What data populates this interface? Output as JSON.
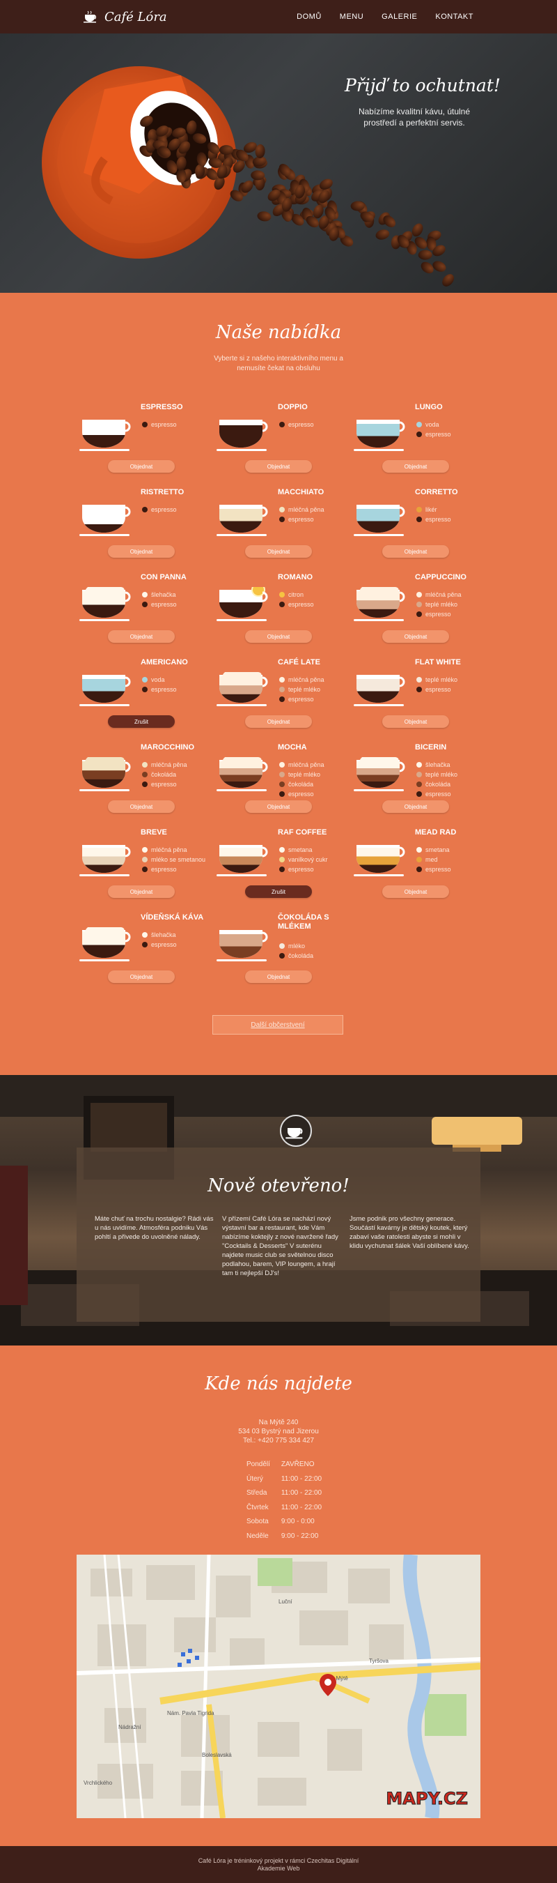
{
  "brand": {
    "name": "Café Lóra"
  },
  "nav": {
    "items": [
      "DOMŮ",
      "MENU",
      "GALERIE",
      "KONTAKT"
    ]
  },
  "hero": {
    "title": "Přijď to ochutnat!",
    "subtitle": "Nabízíme kvalitní kávu, útulné prostředí a perfektní servis."
  },
  "menu": {
    "title": "Naše nabídka",
    "subtitle": "Vyberte si z našeho interaktivního menu a nemusíte čekat na obsluhu",
    "detail_button": "Další občerstvení",
    "order_label": "Objednat",
    "soldout_label": "Zrušit",
    "items": [
      {
        "name": "ESPRESSO",
        "layers": [
          "#3b1a10"
        ],
        "fill": 0.45,
        "ings": [
          [
            "espresso",
            "#3b1a10"
          ]
        ]
      },
      {
        "name": "DOPPIO",
        "layers": [
          "#3b1a10"
        ],
        "fill": 0.8,
        "ings": [
          [
            "espresso",
            "#3b1a10"
          ]
        ]
      },
      {
        "name": "LUNGO",
        "layers": [
          "#3b1a10",
          "#a7d5de"
        ],
        "fill": 0.85,
        "ings": [
          [
            "voda",
            "#a7d5de"
          ],
          [
            "espresso",
            "#3b1a10"
          ]
        ]
      },
      {
        "name": "RISTRETTO",
        "layers": [
          "#3b1a10"
        ],
        "fill": 0.3,
        "ings": [
          [
            "espresso",
            "#3b1a10"
          ]
        ]
      },
      {
        "name": "MACCHIATO",
        "layers": [
          "#3b1a10",
          "#f2e3c2"
        ],
        "fill": 0.85,
        "ings": [
          [
            "mléčná pěna",
            "#f2e3c2"
          ],
          [
            "espresso",
            "#3b1a10"
          ]
        ]
      },
      {
        "name": "CORRETTO",
        "layers": [
          "#3b1a10",
          "#a7d5de"
        ],
        "fill": 0.85,
        "ings": [
          [
            "likér",
            "#e7a23a"
          ],
          [
            "espresso",
            "#3b1a10"
          ]
        ]
      },
      {
        "name": "CON PANNA",
        "layers": [
          "#3b1a10",
          "#fff7ea"
        ],
        "fill": 0.95,
        "foam": true,
        "ings": [
          [
            "šlehačka",
            "#fff7ea"
          ],
          [
            "espresso",
            "#3b1a10"
          ]
        ]
      },
      {
        "name": "ROMANO",
        "layers": [
          "#3b1a10"
        ],
        "fill": 0.55,
        "lemon": true,
        "ings": [
          [
            "citron",
            "#f6c342"
          ],
          [
            "espresso",
            "#3b1a10"
          ]
        ]
      },
      {
        "name": "CAPPUCCINO",
        "layers": [
          "#3b1a10",
          "#d9a88a",
          "#fff1e0"
        ],
        "fill": 0.95,
        "foam": true,
        "ings": [
          [
            "mléčná pěna",
            "#fff1e0"
          ],
          [
            "teplé mléko",
            "#d9a88a"
          ],
          [
            "espresso",
            "#3b1a10"
          ]
        ]
      },
      {
        "name": "AMERICANO",
        "layers": [
          "#3b1a10",
          "#a7d5de"
        ],
        "fill": 0.85,
        "soldout": true,
        "ings": [
          [
            "voda",
            "#a7d5de"
          ],
          [
            "espresso",
            "#3b1a10"
          ]
        ]
      },
      {
        "name": "CAFÉ LATE",
        "layers": [
          "#3b1a10",
          "#d9a88a",
          "#fff1e0"
        ],
        "fill": 0.95,
        "foam": true,
        "ings": [
          [
            "mléčná pěna",
            "#fff1e0"
          ],
          [
            "teplé mléko",
            "#d9a88a"
          ],
          [
            "espresso",
            "#3b1a10"
          ]
        ]
      },
      {
        "name": "FLAT WHITE",
        "layers": [
          "#3b1a10",
          "#f5e9dc"
        ],
        "fill": 0.85,
        "ings": [
          [
            "teplé mléko",
            "#f5e9dc"
          ],
          [
            "espresso",
            "#3b1a10"
          ]
        ]
      },
      {
        "name": "MAROCCHINO",
        "layers": [
          "#3b1a10",
          "#7a3e22",
          "#f2e3c2"
        ],
        "fill": 0.95,
        "foam": true,
        "ings": [
          [
            "mléčná pěna",
            "#f2e3c2"
          ],
          [
            "čokoláda",
            "#7a3e22"
          ],
          [
            "espresso",
            "#3b1a10"
          ]
        ]
      },
      {
        "name": "MOCHA",
        "layers": [
          "#3b1a10",
          "#7a3e22",
          "#d9a88a",
          "#fff1e0"
        ],
        "fill": 0.95,
        "foam": true,
        "ings": [
          [
            "mléčná pěna",
            "#fff1e0"
          ],
          [
            "teplé mléko",
            "#d9a88a"
          ],
          [
            "čokoláda",
            "#7a3e22"
          ],
          [
            "espresso",
            "#3b1a10"
          ]
        ]
      },
      {
        "name": "BICERIN",
        "layers": [
          "#3b1a10",
          "#7a3e22",
          "#d9a88a",
          "#fff7ea"
        ],
        "fill": 0.95,
        "foam": true,
        "ings": [
          [
            "šlehačka",
            "#fff7ea"
          ],
          [
            "teplé mléko",
            "#d9a88a"
          ],
          [
            "čokoláda",
            "#7a3e22"
          ],
          [
            "espresso",
            "#3b1a10"
          ]
        ]
      },
      {
        "name": "BREVE",
        "layers": [
          "#3b1a10",
          "#e8d3b8",
          "#fff7ea"
        ],
        "fill": 0.9,
        "ings": [
          [
            "mléčná pěna",
            "#fff7ea"
          ],
          [
            "mléko se smetanou",
            "#e8d3b8"
          ],
          [
            "espresso",
            "#3b1a10"
          ]
        ]
      },
      {
        "name": "RAF COFFEE",
        "layers": [
          "#3b1a10",
          "#c8885a",
          "#fff7ea"
        ],
        "fill": 0.9,
        "soldout": true,
        "ings": [
          [
            "smetana",
            "#fff7ea"
          ],
          [
            "vanilkový cukr",
            "#f1d88a"
          ],
          [
            "espresso",
            "#3b1a10"
          ]
        ]
      },
      {
        "name": "MEAD RAD",
        "layers": [
          "#3b1a10",
          "#e7a23a",
          "#fff7ea"
        ],
        "fill": 0.9,
        "ings": [
          [
            "smetana",
            "#fff7ea"
          ],
          [
            "med",
            "#e7a23a"
          ],
          [
            "espresso",
            "#3b1a10"
          ]
        ]
      },
      {
        "name": "VÍDEŇSKÁ KÁVA",
        "layers": [
          "#3b1a10",
          "#fff7ea"
        ],
        "fill": 0.95,
        "foam": true,
        "ings": [
          [
            "šlehačka",
            "#fff7ea"
          ],
          [
            "espresso",
            "#3b1a10"
          ]
        ]
      },
      {
        "name": "ČOKOLÁDA S MLÉKEM",
        "layers": [
          "#7a3e22",
          "#d9a88a"
        ],
        "fill": 0.85,
        "ings": [
          [
            "mléko",
            "#f5e9dc"
          ],
          [
            "čokoláda",
            "#3b1a10"
          ]
        ]
      }
    ]
  },
  "news": {
    "title": "Nově otevřeno!",
    "columns": [
      "Máte chuť na trochu nostalgie? Rádi vás u nás uvidíme. Atmosféra podniku Vás pohltí a přivede do uvolněné nálady.",
      "V přízemí Café Lóra se nachází nový výstavní bar a restaurant, kde Vám nabízíme koktejly z nové navržené řady \"Cocktails & Desserts\" V suterénu najdete music club se světelnou disco podlahou, barem, VIP loungem, a hrají tam ti nejlepší DJ's!",
      "Jsme podnik pro všechny generace. Součástí kavárny je dětský koutek, který zabaví vaše ratolesti abyste si mohli v klidu vychutnat šálek Vaší oblíbené kávy."
    ]
  },
  "contact": {
    "title": "Kde nás najdete",
    "address": [
      "Na Mýtě 240",
      "534 03 Bystrý nad Jizerou",
      "Tel.: +420 775 334 427"
    ],
    "hours": [
      [
        "Pondělí",
        "ZAVŘENO"
      ],
      [
        "Úterý",
        "11:00 - 22:00"
      ],
      [
        "Středa",
        "11:00 - 22:00"
      ],
      [
        "Čtvrtek",
        "11:00 - 22:00"
      ],
      [
        "Sobota",
        "9:00 - 0:00"
      ],
      [
        "Neděle",
        "9:00 - 22:00"
      ]
    ],
    "map": {
      "logo": "MAPY.CZ",
      "streets": [
        "Tyršova",
        "Na Mýtě",
        "Nám. Pavla Tigrida",
        "Nádražní",
        "Luční",
        "Boleslavská",
        "Vrchlického"
      ]
    }
  },
  "footer": {
    "line1": "Café Lóra je tréninkový projekt v rámci Czechitas Digitální",
    "line2": "Akademie Web"
  },
  "colors": {
    "accent": "#e8774b",
    "dark": "#3e1f19",
    "button": "#f2946b",
    "soldout": "#6a2b1f"
  }
}
